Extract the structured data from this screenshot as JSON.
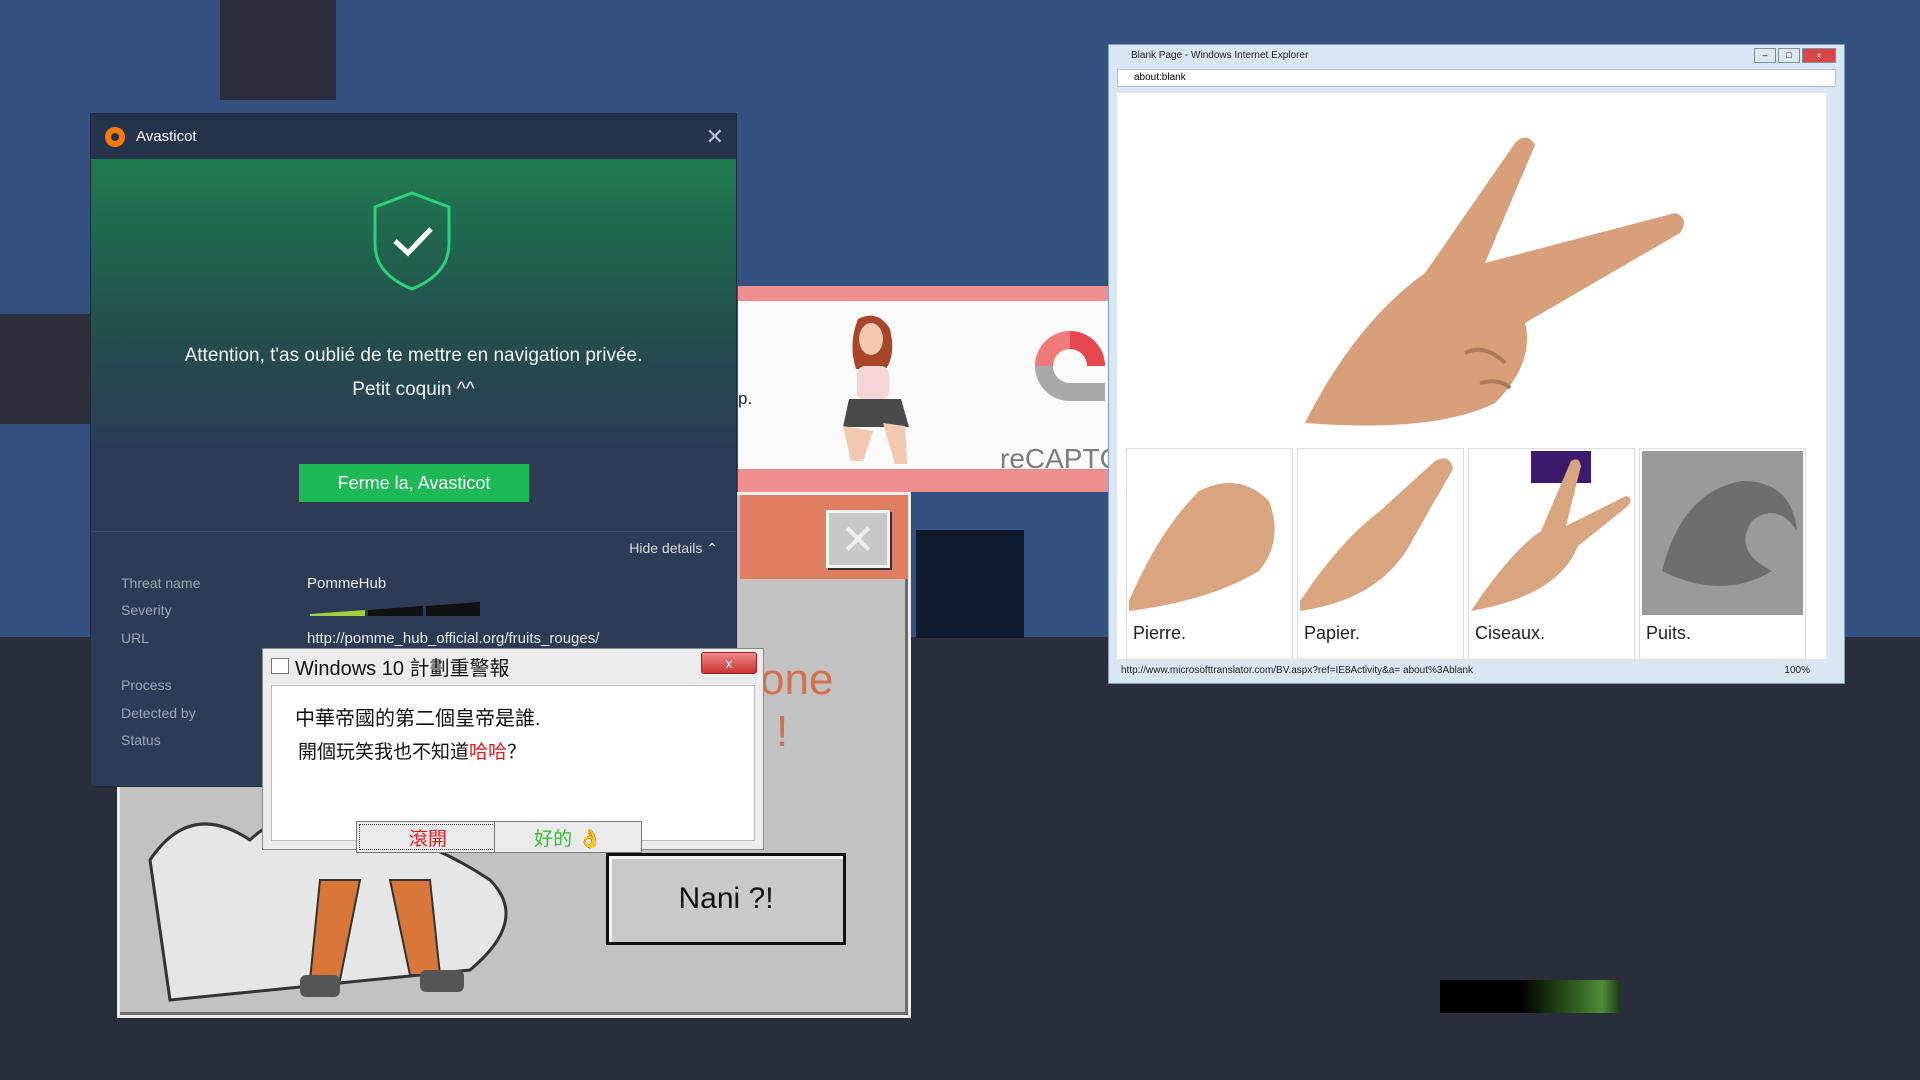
{
  "avast": {
    "title": "Avasticot",
    "close": "✕",
    "message_line1": "Attention, t'as oublié de te mettre en navigation privée.",
    "message_line2": "Petit coquin ^^",
    "button": "Ferme la, Avasticot",
    "hide_details": "Hide details ⌃",
    "details": {
      "threat_name_label": "Threat name",
      "threat_name_value": "PommeHub",
      "severity_label": "Severity",
      "url_label": "URL",
      "url_value": "http://pomme_hub_official.org/fruits_rouges/",
      "process_label": "Process",
      "detected_by_label": "Detected by",
      "status_label": "Status"
    }
  },
  "captcha": {
    "text": "reCAPTC",
    "partial_text": "p."
  },
  "retro": {
    "close_glyph": "✕",
    "text_line1": "one",
    "text_line2": "i !",
    "nani_button": "Nani ?!"
  },
  "win_dialog": {
    "title": "Windows 10 計劃重警報",
    "close": "x",
    "line1": "中華帝國的第二個皇帝是誰.",
    "line2_prefix": "開個玩笑我也不知道",
    "line2_red": "哈哈",
    "line2_suffix": "？",
    "button_leave": "滾開",
    "button_ok": "好的",
    "ok_emoji": "👌"
  },
  "ie": {
    "title": "Blank Page - Windows Internet Explorer",
    "address": "about:blank",
    "status_url": "http://www.microsofttranslator.com/BV.aspx?ref=IE8Activity&a= about%3Ablank",
    "zoom": "100%",
    "cards": [
      {
        "label": "Pierre."
      },
      {
        "label": "Papier."
      },
      {
        "label": "Ciseaux."
      },
      {
        "label": "Puits."
      }
    ]
  }
}
